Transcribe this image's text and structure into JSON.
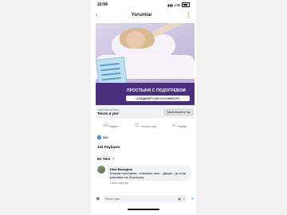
{
  "status_bar": {
    "time": "10:59",
    "network": "LTE",
    "icons": [
      "signal-icon",
      "lte-icon",
      "battery-icon"
    ]
  },
  "nav": {
    "title": "Yorumlar",
    "back_icon": "chevron-left-icon",
    "more_icon": "more-vertical-icon"
  },
  "ad": {
    "headline": "ПРОСТЫНЯ С ПОДОГРЕВОМ",
    "subline": "СЛАДКИЙ СОН И КОМФОРТ",
    "brand_color": "#4a2f7c"
  },
  "cta": {
    "domain": "TEPLOISUGAT.NET",
    "title": "Тепло и уют",
    "button_label": "Şimdi Alışveriş Yap"
  },
  "actions": [
    {
      "label": "Beğen",
      "icon": "thumbs-up-icon"
    },
    {
      "label": "Yorum yap",
      "icon": "comment-icon"
    },
    {
      "label": "Paylaş",
      "icon": "share-icon"
    }
  ],
  "reactions": {
    "count": "580",
    "icon": "like-icon",
    "color": "#1877f2"
  },
  "shares": "104 Paylaşım",
  "sort": {
    "label": "En Yeni",
    "icon": "chevron-down-icon"
  },
  "comment": {
    "author": "Ніна Валедіна",
    "text": "Класна простинка...спасаєсь нею....Дякую...(а то як реклама так Лохотрон)",
    "meta": "Сенін'ліні Kab"
  },
  "input": {
    "placeholder": "Yorum yaz...",
    "icons": [
      "camera-icon",
      "gif-icon",
      "sticker-icon",
      "send-icon"
    ]
  }
}
